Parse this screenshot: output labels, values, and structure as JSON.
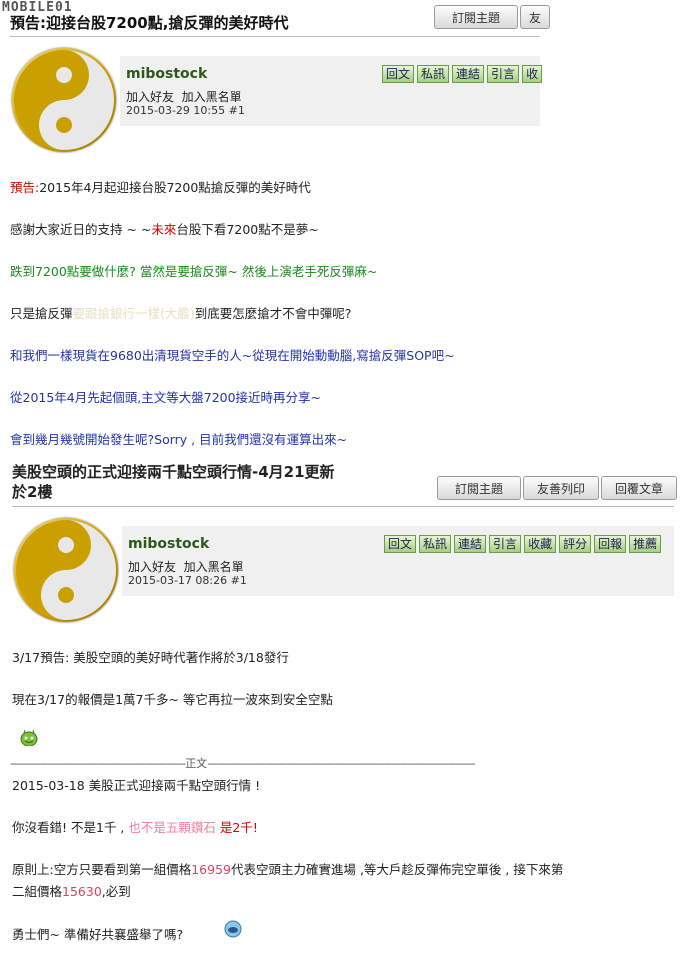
{
  "site": {
    "logo_text": "MOBILE01"
  },
  "post1": {
    "title": "預告:迎接台股7200點,搶反彈的美好時代",
    "toolbar": [
      "訂閱主題",
      "友"
    ],
    "user": {
      "name": "mibostock",
      "add_friend": "加入好友",
      "add_block": "加入黑名單",
      "date": "2015-03-29 10:55",
      "floor": "#1"
    },
    "actions": [
      "回文",
      "私訊",
      "連結",
      "引言",
      "收"
    ],
    "body": {
      "l1_prefix": "預告:",
      "l1_text": "2015年4月起迎接台股7200點搶反彈的美好時代",
      "l2_a": "感謝大家近日的支持 ~ ~",
      "l2_red": "未來",
      "l2_b": "台股下看7200點不是夢~",
      "l3": "跌到7200點要做什麼? 當然是要搶反彈~ 然後上演老手死反彈麻~",
      "l4_a": "只是搶反彈",
      "l4_faint": "要跟搶銀行一樣(大膽)",
      "l4_b": "到底要怎麼搶才不會中彈呢?",
      "l5": "和我們一樣現貨在9680出清現貨空手的人~從現在開始動動腦,寫搶反彈SOP吧~",
      "l6": "從2015年4月先起個頭,主文等大盤7200接近時再分享~",
      "l7": "會到幾月幾號開始發生呢?Sorry , 目前我們還沒有運算出來~"
    }
  },
  "post2": {
    "title_line1": "美股空頭的正式迎接兩千點空頭行情-4月21更新",
    "title_line2": "於2樓",
    "toolbar": [
      "訂閱主題",
      "友善列印",
      "回覆文章"
    ],
    "user": {
      "name": "mibostock",
      "add_friend": "加入好友",
      "add_block": "加入黑名單",
      "date": "2015-03-17 08:26",
      "floor": "#1"
    },
    "actions": [
      "回文",
      "私訊",
      "連結",
      "引言",
      "收藏",
      "評分",
      "回報",
      "推薦"
    ],
    "body": {
      "l1": "3/17預告: 美股空頭的美好時代著作將於3/18發行",
      "l2": "現在3/17的報價是1萬7千多~ 等它再拉一波來到安全空點",
      "divider_left": "-----------------------------------------------------------",
      "divider_label": "正文",
      "divider_right": "------------------------------------------------------------------------------------------",
      "l3": "2015-03-18 美股正式迎接兩千點空頭行情 !",
      "l4_a": "你沒看錯! 不是1千 ,",
      "l4_b": "也不是五顆鑽石",
      "l4_c": "是2千!",
      "l5_a": "原則上:空方只要看到第一組價格",
      "l5_num1": "16959",
      "l5_b": "代表空頭主力確實進場 ,等大戶趁反彈佈完空單後 , 接下來第",
      "l6_a": "二組價格",
      "l6_num2": "15630",
      "l6_b": ",必到",
      "l7": "勇士們~ 準備好共襄盛舉了嗎?"
    }
  },
  "colors": {
    "red": "#d40000",
    "green": "#1a8a1a",
    "blue": "#2233aa",
    "pink": "#e04060"
  }
}
